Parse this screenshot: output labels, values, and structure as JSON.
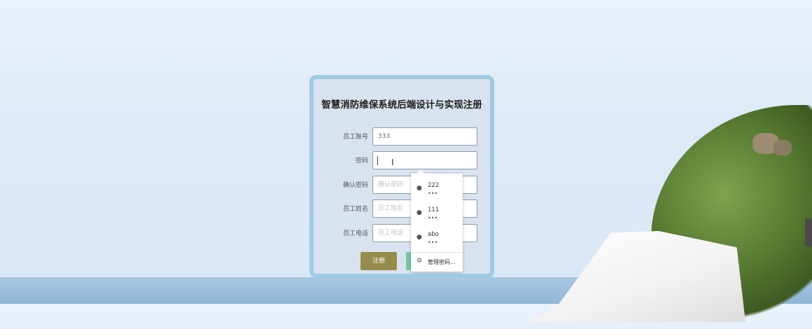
{
  "page": {
    "title": "智慧消防维保系统后端设计与实现注册"
  },
  "form": {
    "fields": [
      {
        "label": "员工账号",
        "value": "333",
        "placeholder": ""
      },
      {
        "label": "密码",
        "value": "",
        "placeholder": ""
      },
      {
        "label": "确认密码",
        "value": "",
        "placeholder": "确认密码"
      },
      {
        "label": "员工姓名",
        "value": "",
        "placeholder": "员工姓名"
      },
      {
        "label": "员工电话",
        "value": "",
        "placeholder": "员工电话"
      }
    ],
    "register_label": "注册"
  },
  "password_popup": {
    "suggestions": [
      {
        "username": "222",
        "masked": "•••"
      },
      {
        "username": "111",
        "masked": "•••"
      },
      {
        "username": "abo",
        "masked": "•••"
      }
    ],
    "manage_label": "管理密码..."
  },
  "icons": {
    "suggestion": "key-globe-icon",
    "manage": "settings-icon"
  },
  "colors": {
    "card_border": "#9fcbe2",
    "register_button": "#968c4a",
    "secondary_button": "#74c9a2"
  }
}
